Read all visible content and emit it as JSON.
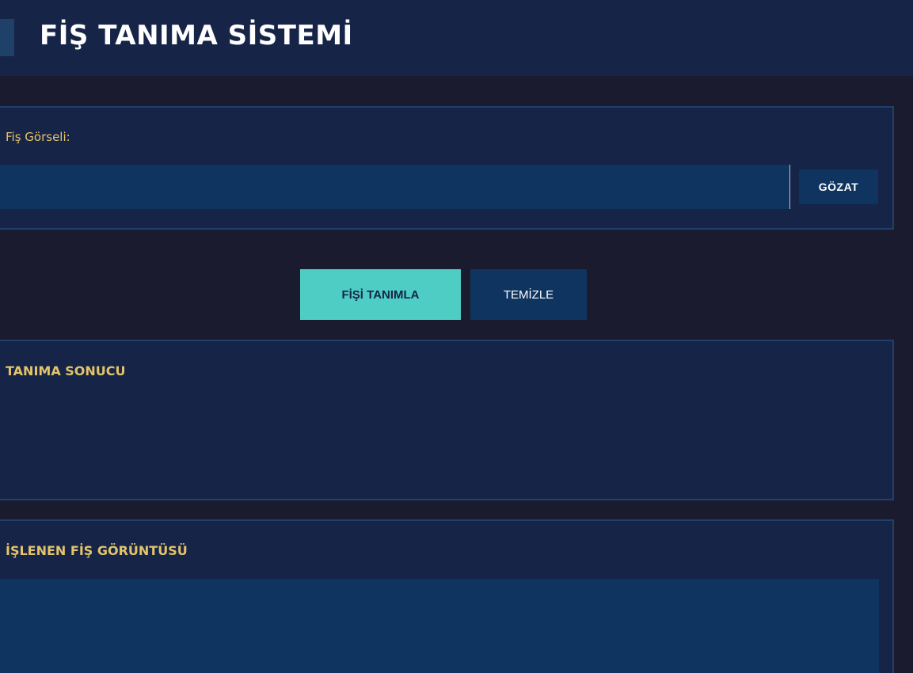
{
  "header": {
    "title": "FİŞ TANIMA SİSTEMİ"
  },
  "upload": {
    "label": "Fiş Görseli:",
    "file_value": "",
    "browse_label": "GÖZAT"
  },
  "actions": {
    "recognize_label": "FİŞİ TANIMLA",
    "clear_label": "TEMİZLE"
  },
  "result": {
    "title": "TANIMA SONUCU",
    "text": ""
  },
  "processed_image": {
    "title": "İŞLENEN FİŞ GÖRÜNTÜSÜ"
  },
  "colors": {
    "background": "#1b1b2f",
    "panel": "#162447",
    "panel_border": "#1f4068",
    "field": "#0f3460",
    "accent_teal": "#4ecdc4",
    "label_gold": "#e4c46a"
  }
}
